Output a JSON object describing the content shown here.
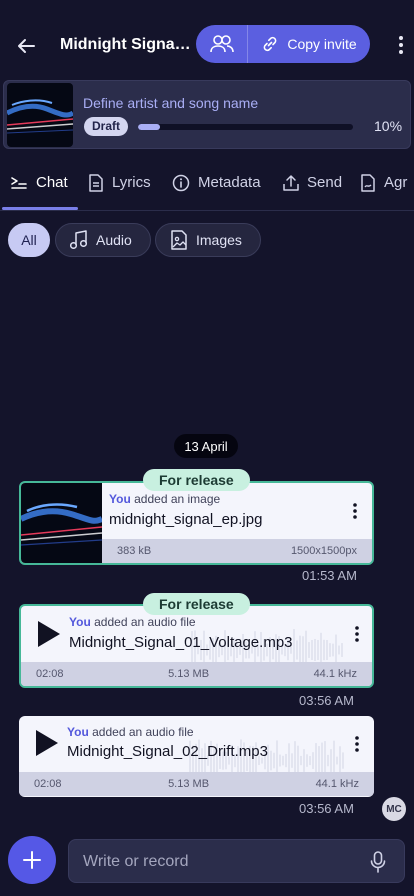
{
  "header": {
    "title": "Midnight Signal EP",
    "title_display": "Midnight Signa…",
    "copy_invite_label": "Copy invite"
  },
  "release": {
    "title": "Define artist and song name",
    "status": "Draft",
    "progress_fraction": 0.1,
    "progress_label": "10%"
  },
  "tabs": [
    {
      "label": "Chat",
      "icon": "chat-icon"
    },
    {
      "label": "Lyrics",
      "icon": "document-icon"
    },
    {
      "label": "Metadata",
      "icon": "info-icon"
    },
    {
      "label": "Send",
      "icon": "upload-icon"
    },
    {
      "label": "Agr",
      "icon": "agreement-icon"
    }
  ],
  "filters": [
    {
      "label": "All"
    },
    {
      "label": "Audio",
      "icon": "music-note-icon"
    },
    {
      "label": "Images",
      "icon": "image-icon"
    }
  ],
  "date_separator": "13 April",
  "messages": [
    {
      "badge": "For release",
      "author": "You",
      "action": "added an image",
      "filename": "midnight_signal_ep.jpg",
      "size": "383 kB",
      "detail": "1500x1500px",
      "time": "01:53 AM"
    },
    {
      "badge": "For release",
      "author": "You",
      "action": "added an audio file",
      "filename": "Midnight_Signal_01_Voltage.mp3",
      "duration": "02:08",
      "size": "5.13 MB",
      "detail": "44.1 kHz",
      "time": "03:56 AM"
    },
    {
      "author": "You",
      "action": "added an audio file",
      "filename": "Midnight_Signal_02_Drift.mp3",
      "duration": "02:08",
      "size": "5.13 MB",
      "detail": "44.1 kHz",
      "time": "03:56 AM"
    }
  ],
  "avatar_initials": "MC",
  "compose": {
    "placeholder": "Write or record"
  },
  "colors": {
    "background": "#14142b",
    "accent": "#5b5fe0",
    "release_border": "#46b898",
    "badge_bg": "#c8f0e0"
  }
}
